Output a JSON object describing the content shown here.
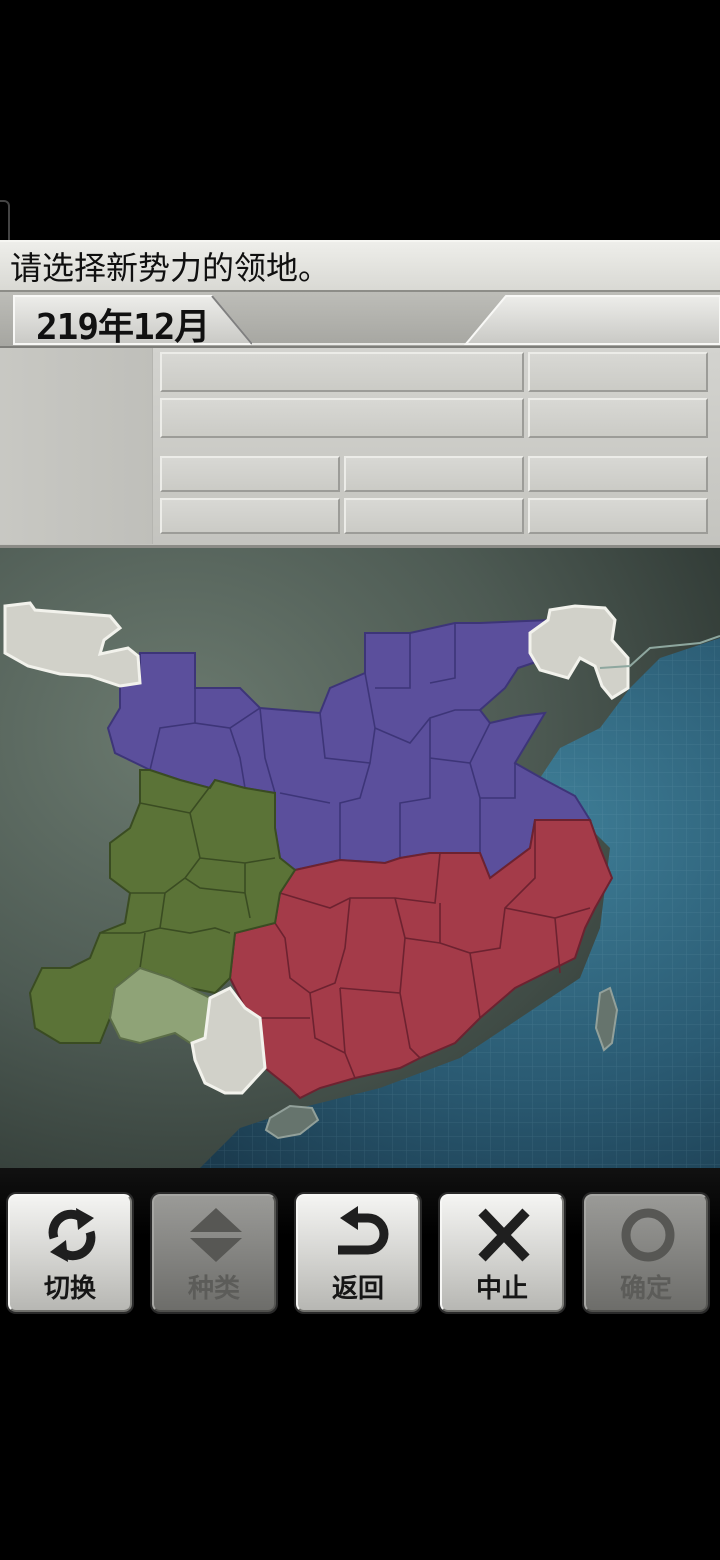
{
  "prompt": {
    "text": "请选择新势力的领地。"
  },
  "header": {
    "date": "219年12月"
  },
  "colors": {
    "faction_purple": "#5a4f9a",
    "faction_red": "#a43a48",
    "faction_green": "#5b7338",
    "faction_light_green": "#8ea276",
    "neutral_gray": "#cfcfc7",
    "sea": "#2f5f78",
    "land": "#52605a"
  },
  "toolbar": {
    "buttons": [
      {
        "label": "切换",
        "icon": "switch-cycle-icon",
        "enabled": true
      },
      {
        "label": "种类",
        "icon": "up-down-arrows-icon",
        "enabled": false
      },
      {
        "label": "返回",
        "icon": "undo-arrow-icon",
        "enabled": true
      },
      {
        "label": "中止",
        "icon": "x-cross-icon",
        "enabled": true
      },
      {
        "label": "确定",
        "icon": "circle-confirm-icon",
        "enabled": false
      }
    ]
  }
}
